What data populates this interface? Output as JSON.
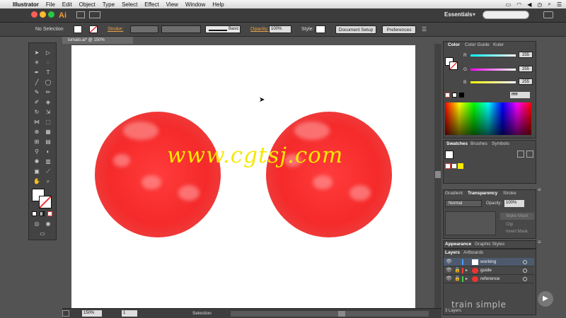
{
  "menubar": {
    "app_name": "Illustrator",
    "items": [
      "File",
      "Edit",
      "Object",
      "Type",
      "Select",
      "Effect",
      "View",
      "Window",
      "Help"
    ]
  },
  "appbar": {
    "logo": "Ai",
    "workspace": "Essentials"
  },
  "controlbar": {
    "selection_status": "No Selection",
    "stroke_label": "Stroke:",
    "stroke_style": "Basic",
    "opacity_label": "Opacity:",
    "opacity_value": "100%",
    "style_label": "Style:",
    "document_setup": "Document Setup",
    "preferences": "Preferences"
  },
  "document": {
    "tab_title": "tomato.ai* @ 150% (RGB/Preview)",
    "watermark": "www.cgtsj.com"
  },
  "statusbar": {
    "zoom": "150%",
    "artboard": "1",
    "tool": "Selection"
  },
  "color_panel": {
    "tabs": [
      "Color",
      "Color Guide",
      "Kuler"
    ],
    "channels": [
      {
        "label": "R",
        "value": "255",
        "color": "#ff2a2a"
      },
      {
        "label": "G",
        "value": "255",
        "color": "#ff00ff"
      },
      {
        "label": "B",
        "value": "255",
        "color": "#ffee00"
      }
    ],
    "hex": "ffffff"
  },
  "swatches_panel": {
    "tabs": [
      "Swatches",
      "Brushes",
      "Symbols"
    ]
  },
  "transparency_panel": {
    "tabs": [
      "Gradient",
      "Transparency",
      "Stroke"
    ],
    "blend_mode": "Normal",
    "opacity_label": "Opacity:",
    "opacity_value": "100%",
    "make_mask": "Make Mask",
    "clip": "Clip",
    "invert_mask": "Invert Mask"
  },
  "appearance_panel": {
    "tabs": [
      "Appearance",
      "Graphic Styles"
    ]
  },
  "layers_panel": {
    "tabs": [
      "Layers",
      "Artboards"
    ],
    "layers": [
      {
        "name": "working",
        "color": "#4a9cff"
      },
      {
        "name": "guide",
        "color": "#ff3c3c"
      },
      {
        "name": "reference",
        "color": "#3cd24b"
      }
    ],
    "count": "3 Layers"
  },
  "branding": {
    "text": "train simple"
  }
}
